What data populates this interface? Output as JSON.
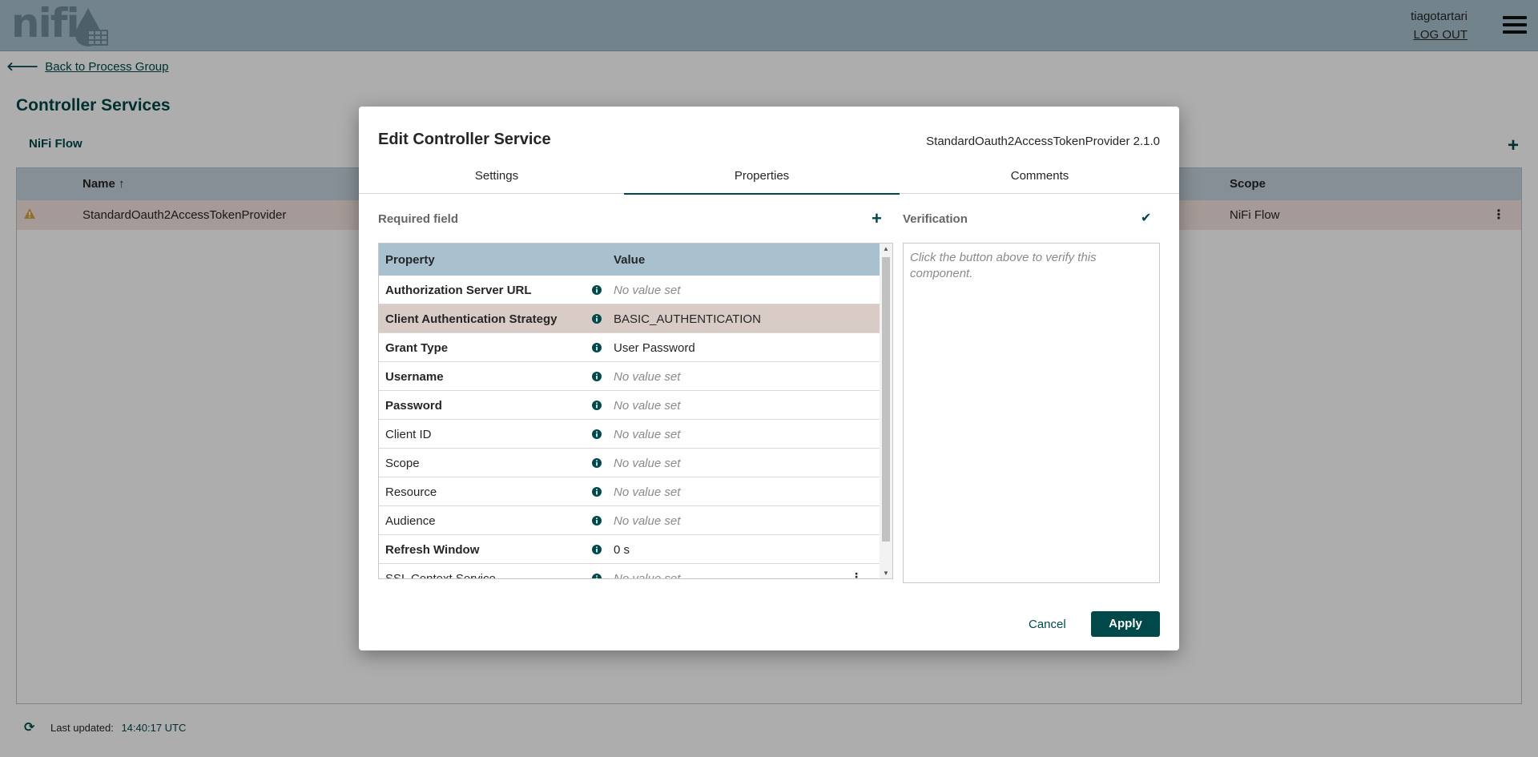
{
  "header": {
    "logo_text": "nifi",
    "username": "tiagotartari",
    "logout_label": "LOG OUT"
  },
  "page": {
    "back_link": "Back to Process Group",
    "title": "Controller Services",
    "breadcrumb": "NiFi Flow",
    "table": {
      "columns": [
        "Name",
        "Scope"
      ],
      "sort_indicator": "↑",
      "rows": [
        {
          "name": "StandardOauth2AccessTokenProvider",
          "scope": "NiFi Flow",
          "status": "warning"
        }
      ]
    },
    "footer": {
      "label": "Last updated:",
      "time": "14:40:17 UTC"
    }
  },
  "dialog": {
    "title": "Edit Controller Service",
    "component_type": "StandardOauth2AccessTokenProvider 2.1.0",
    "tabs": [
      "Settings",
      "Properties",
      "Comments"
    ],
    "active_tab": "Properties",
    "required_field_label": "Required field",
    "verification_label": "Verification",
    "verification_placeholder": "Click the button above to verify this component.",
    "properties_columns": [
      "Property",
      "Value"
    ],
    "properties": [
      {
        "name": "Authorization Server URL",
        "value": "No value set",
        "required": true,
        "empty": true
      },
      {
        "name": "Client Authentication Strategy",
        "value": "BASIC_AUTHENTICATION",
        "required": true,
        "empty": false,
        "selected": true
      },
      {
        "name": "Grant Type",
        "value": "User Password",
        "required": true,
        "empty": false
      },
      {
        "name": "Username",
        "value": "No value set",
        "required": true,
        "empty": true
      },
      {
        "name": "Password",
        "value": "No value set",
        "required": true,
        "empty": true
      },
      {
        "name": "Client ID",
        "value": "No value set",
        "required": false,
        "empty": true
      },
      {
        "name": "Scope",
        "value": "No value set",
        "required": false,
        "empty": true
      },
      {
        "name": "Resource",
        "value": "No value set",
        "required": false,
        "empty": true
      },
      {
        "name": "Audience",
        "value": "No value set",
        "required": false,
        "empty": true
      },
      {
        "name": "Refresh Window",
        "value": "0 s",
        "required": true,
        "empty": false
      },
      {
        "name": "SSL Context Service",
        "value": "No value set",
        "required": false,
        "empty": true,
        "has_menu": true
      }
    ],
    "cancel_label": "Cancel",
    "apply_label": "Apply"
  },
  "colors": {
    "brand": "#004849",
    "header": "#a9c1cf",
    "selected_row": "#d9ccc7",
    "warning": "#d9a441"
  }
}
